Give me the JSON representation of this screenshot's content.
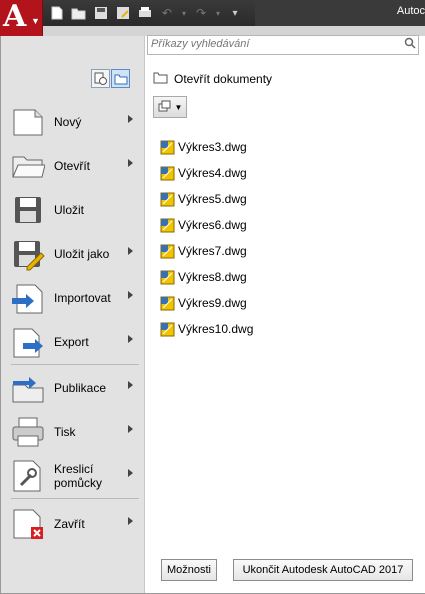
{
  "app": {
    "title": "Autoc"
  },
  "search": {
    "placeholder": "Příkazy vyhledávání"
  },
  "recent": {
    "title": "Otevřít dokumenty"
  },
  "menu_items": [
    {
      "label": "Nový",
      "icon": "new-document-icon",
      "arrow": true
    },
    {
      "label": "Otevřít",
      "icon": "open-folder-icon",
      "arrow": true
    },
    {
      "label": "Uložit",
      "icon": "floppy-disk-icon",
      "arrow": false
    },
    {
      "label": "Uložit jako",
      "icon": "save-as-icon",
      "arrow": true
    },
    {
      "label": "Importovat",
      "icon": "import-icon",
      "arrow": true
    },
    {
      "label": "Export",
      "icon": "export-icon",
      "arrow": true
    },
    {
      "label": "Publikace",
      "icon": "publish-icon",
      "arrow": true
    },
    {
      "label": "Tisk",
      "icon": "printer-icon",
      "arrow": true
    },
    {
      "label": "Kreslicí pomůcky",
      "icon": "drawing-utilities-icon",
      "arrow": true
    },
    {
      "label": "Zavřít",
      "icon": "close-document-icon",
      "arrow": true
    }
  ],
  "files": [
    "Výkres3.dwg",
    "Výkres4.dwg",
    "Výkres5.dwg",
    "Výkres6.dwg",
    "Výkres7.dwg",
    "Výkres8.dwg",
    "Výkres9.dwg",
    "Výkres10.dwg"
  ],
  "footer": {
    "options_label": "Možnosti",
    "exit_label": "Ukončit Autodesk AutoCAD 2017"
  },
  "colors": {
    "app_button": "#b3131b",
    "titlebar": "#2f2f2f",
    "accent": "#2c6fc4"
  }
}
